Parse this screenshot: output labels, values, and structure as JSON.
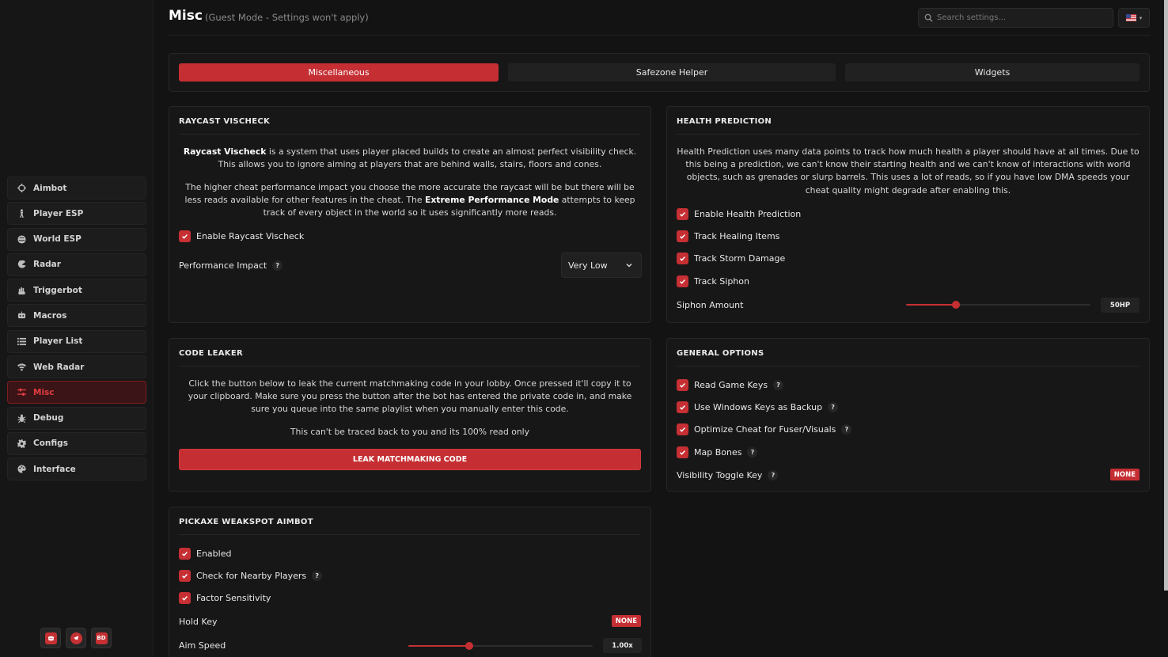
{
  "header": {
    "title": "Misc",
    "subtitle": "(Guest Mode - Settings won't apply)",
    "search_placeholder": "Search settings..."
  },
  "sidebar": {
    "items": [
      {
        "label": "Aimbot",
        "icon": "crosshair-icon"
      },
      {
        "label": "Player ESP",
        "icon": "person-icon"
      },
      {
        "label": "World ESP",
        "icon": "globe-icon"
      },
      {
        "label": "Radar",
        "icon": "radar-icon"
      },
      {
        "label": "Triggerbot",
        "icon": "hand-icon"
      },
      {
        "label": "Macros",
        "icon": "robot-icon"
      },
      {
        "label": "Player List",
        "icon": "list-icon"
      },
      {
        "label": "Web Radar",
        "icon": "wifi-icon"
      },
      {
        "label": "Misc",
        "icon": "sliders-icon",
        "active": true
      },
      {
        "label": "Debug",
        "icon": "bug-icon"
      },
      {
        "label": "Configs",
        "icon": "gear-icon"
      },
      {
        "label": "Interface",
        "icon": "palette-icon"
      }
    ],
    "social": [
      "discord-icon",
      "telegram-icon",
      "BD"
    ]
  },
  "tabs": [
    "Miscellaneous",
    "Safezone Helper",
    "Widgets"
  ],
  "raycast": {
    "title": "RAYCAST VISCHECK",
    "desc1_bold": "Raycast Vischeck",
    "desc1_rest": " is a system that uses player placed builds to create an almost perfect visibility check. This allows you to ignore aiming at players that are behind walls, stairs, floors and cones.",
    "desc2_a": "The higher cheat performance impact you choose the more accurate the raycast will be but there will be less reads available for other features in the cheat. The ",
    "desc2_bold": "Extreme Performance Mode",
    "desc2_b": " attempts to keep track of every object in the world so it uses significantly more reads.",
    "enable_label": "Enable Raycast Vischeck",
    "perf_label": "Performance Impact",
    "perf_value": "Very Low"
  },
  "health": {
    "title": "HEALTH PREDICTION",
    "desc": "Health Prediction uses many data points to track how much health a player should have at all times. Due to this being a prediction, we can't know their starting health and we can't know of interactions with world objects, such as grenades or slurp barrels. This uses a lot of reads, so if you have low DMA speeds your cheat quality might degrade after enabling this.",
    "options": [
      "Enable Health Prediction",
      "Track Healing Items",
      "Track Storm Damage",
      "Track Siphon"
    ],
    "siphon_label": "Siphon Amount",
    "siphon_value": "50HP",
    "siphon_fraction": 0.27
  },
  "code_leaker": {
    "title": "CODE LEAKER",
    "desc": "Click the button below to leak the current matchmaking code in your lobby. Once pressed it'll copy it to your clipboard. Make sure you press the button after the bot has entered the private code in, and make sure you queue into the same playlist when you manually enter this code.",
    "note": "This can't be traced back to you and its 100% read only",
    "button": "LEAK MATCHMAKING CODE"
  },
  "general": {
    "title": "GENERAL OPTIONS",
    "options": [
      "Read Game Keys",
      "Use Windows Keys as Backup",
      "Optimize Cheat for Fuser/Visuals",
      "Map Bones"
    ],
    "vis_label": "Visibility Toggle Key",
    "vis_value": "NONE"
  },
  "pickaxe": {
    "title": "PICKAXE WEAKSPOT AIMBOT",
    "options": [
      "Enabled",
      "Check for Nearby Players",
      "Factor Sensitivity"
    ],
    "hold_label": "Hold Key",
    "hold_value": "NONE",
    "speed_label": "Aim Speed",
    "speed_value": "1.00x",
    "speed_fraction": 0.33
  },
  "help_glyph": "?",
  "colors": {
    "accent": "#c52f33",
    "background": "#131313",
    "panel": "#171717"
  }
}
